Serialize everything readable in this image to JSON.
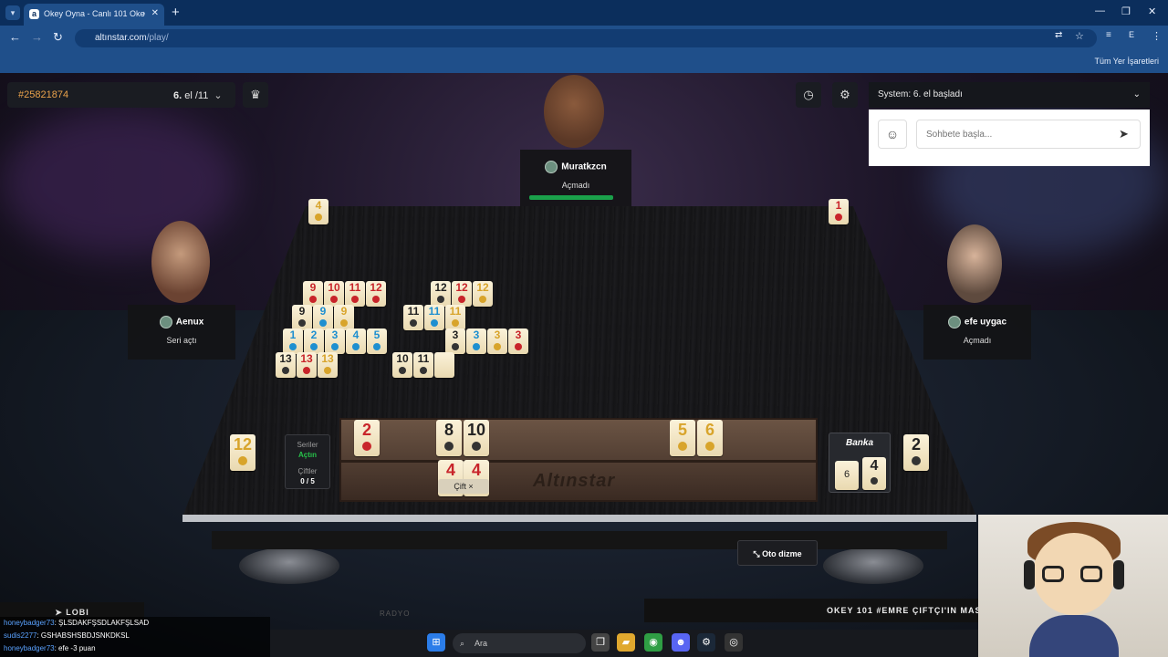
{
  "browser": {
    "tab_title": "Okey Oyna - Canlı 101 Oke",
    "tab_favicon": "a",
    "url_host": "altınstar.com",
    "url_path": "/play/",
    "bookmarks_label": "Tüm Yer İşaretleri",
    "profile_initial": "E"
  },
  "game": {
    "room_id": "#25821874",
    "round_current": "6.",
    "round_rest": " el /11",
    "system_message": "System: 6. el başladı",
    "chat_placeholder": "Sohbete başla...",
    "players": {
      "top": {
        "name": "Muratkzcn",
        "status": "Açmadı"
      },
      "left": {
        "name": "Aenux",
        "status": "Seri açtı"
      },
      "right": {
        "name": "efe uygac",
        "status": "Açmadı"
      }
    },
    "corner_tiles": {
      "top_left": {
        "value": "4",
        "color": "yellow"
      },
      "top_right": {
        "value": "1",
        "color": "red"
      },
      "discard_left": {
        "value": "12",
        "color": "yellow"
      },
      "discard_right": {
        "value": "2",
        "color": "black"
      }
    },
    "table_groups": [
      {
        "row": 0,
        "tiles": [
          [
            "9",
            "red"
          ],
          [
            "10",
            "red"
          ],
          [
            "11",
            "red"
          ],
          [
            "12",
            "red"
          ]
        ]
      },
      {
        "row": 0,
        "tiles": [
          [
            "12",
            "black"
          ],
          [
            "12",
            "red"
          ],
          [
            "12",
            "yellow"
          ]
        ]
      },
      {
        "row": 1,
        "tiles": [
          [
            "9",
            "black"
          ],
          [
            "9",
            "blue"
          ],
          [
            "9",
            "yellow"
          ]
        ]
      },
      {
        "row": 1,
        "tiles": [
          [
            "11",
            "black"
          ],
          [
            "11",
            "blue"
          ],
          [
            "11",
            "yellow"
          ]
        ]
      },
      {
        "row": 2,
        "tiles": [
          [
            "1",
            "blue"
          ],
          [
            "2",
            "blue"
          ],
          [
            "3",
            "blue"
          ],
          [
            "4",
            "blue"
          ],
          [
            "5",
            "blue"
          ]
        ]
      },
      {
        "row": 2,
        "tiles": [
          [
            "3",
            "black"
          ],
          [
            "3",
            "blue"
          ],
          [
            "3",
            "yellow"
          ],
          [
            "3",
            "red"
          ]
        ]
      },
      {
        "row": 3,
        "tiles": [
          [
            "13",
            "black"
          ],
          [
            "13",
            "red"
          ],
          [
            "13",
            "yellow"
          ]
        ]
      },
      {
        "row": 3,
        "tiles": [
          [
            "10",
            "black"
          ],
          [
            "11",
            "black"
          ],
          [
            "",
            "blank"
          ]
        ]
      }
    ],
    "rack": {
      "top": [
        [
          "2",
          "red"
        ],
        [
          "8",
          "black"
        ],
        [
          "10",
          "black"
        ],
        [
          "5",
          "yellow"
        ],
        [
          "6",
          "yellow"
        ]
      ],
      "bottom": [
        [
          "4",
          "red"
        ],
        [
          "4",
          "red"
        ]
      ],
      "logo": "Altınstar",
      "pair_button": "Çift ×"
    },
    "series_panel": {
      "series_label": "Seriler",
      "series_state": "Açtın",
      "pairs_label": "Çiftler",
      "pairs_count": "0 / 5"
    },
    "bank": {
      "label": "Banka",
      "count": "6",
      "tile": [
        "4",
        "black"
      ]
    },
    "auto_sort_label": "Oto dizme",
    "lobby_label": "LOBI",
    "radio_label": "RADYO",
    "marquee": "OKEY 101 #EMRE ÇIFTÇI'IN MASASI"
  },
  "chat_log": [
    {
      "user": "honeybadger73",
      "text": ": ŞLSDAKFŞSDLAKFŞLSAD"
    },
    {
      "user": "sudis2277",
      "text": ": GSHABSHSBDJSNKDKSL"
    },
    {
      "user": "honeybadger73",
      "text": ": efe -3 puan"
    }
  ],
  "taskbar": {
    "search_placeholder": "Ara"
  },
  "colors": {
    "accent": "#e9a24b",
    "browser": "#0b2e5c",
    "green": "#1aa14a",
    "red": "#c8242a",
    "blue": "#1e8fd0",
    "yellow": "#d8a42b"
  }
}
